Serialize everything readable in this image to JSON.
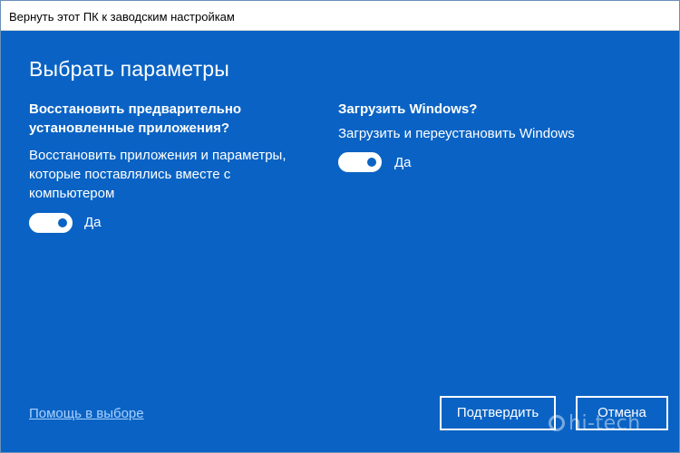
{
  "window": {
    "title": "Вернуть этот ПК к заводским настройкам"
  },
  "page": {
    "heading": "Выбрать параметры"
  },
  "options": {
    "restore_apps": {
      "title_line1": "Восстановить предварительно",
      "title_line2": "установленные приложения?",
      "desc_line1": "Восстановить приложения и параметры,",
      "desc_line2": "которые поставлялись вместе с",
      "desc_line3": "компьютером",
      "toggle_state": "on",
      "toggle_label": "Да"
    },
    "download_windows": {
      "title": "Загрузить Windows?",
      "desc": "Загрузить и переустановить Windows",
      "toggle_state": "on",
      "toggle_label": "Да"
    }
  },
  "footer": {
    "help_link": "Помощь в выборе",
    "confirm_label": "Подтвердить",
    "cancel_label": "Отмена"
  },
  "watermark": {
    "text": "hi-tech"
  },
  "colors": {
    "background": "#0a63c4",
    "link": "#a9d1ff",
    "titlebar": "#ffffff"
  }
}
